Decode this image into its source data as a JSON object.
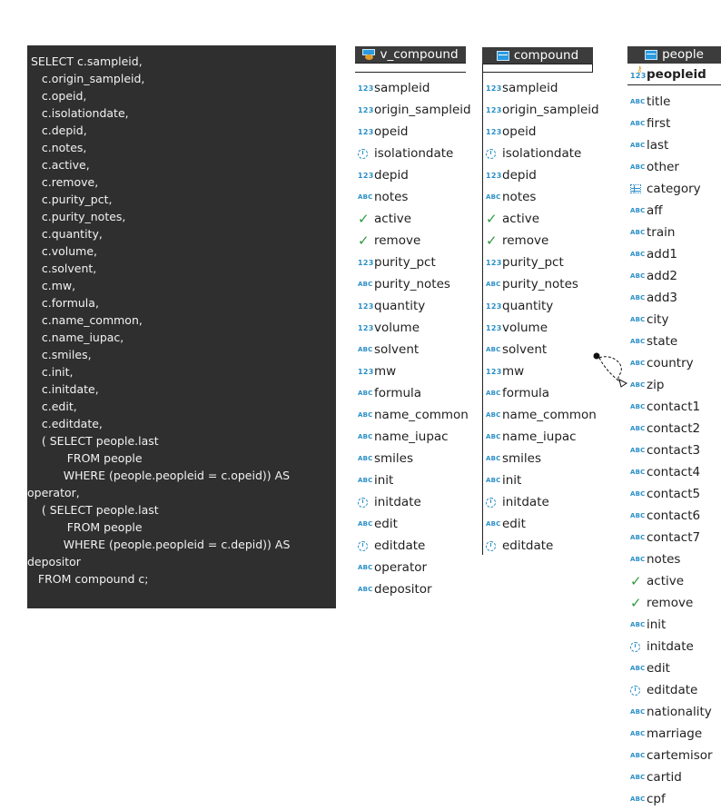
{
  "sql": {
    "lines": [
      " SELECT c.sampleid,",
      "    c.origin_sampleid,",
      "    c.opeid,",
      "    c.isolationdate,",
      "    c.depid,",
      "    c.notes,",
      "    c.active,",
      "    c.remove,",
      "    c.purity_pct,",
      "    c.purity_notes,",
      "    c.quantity,",
      "    c.volume,",
      "    c.solvent,",
      "    c.mw,",
      "    c.formula,",
      "    c.name_common,",
      "    c.name_iupac,",
      "    c.smiles,",
      "    c.init,",
      "    c.initdate,",
      "    c.edit,",
      "    c.editdate,",
      "    ( SELECT people.last",
      "           FROM people",
      "          WHERE (people.peopleid = c.opeid)) AS",
      "operator,",
      "    ( SELECT people.last",
      "           FROM people",
      "          WHERE (people.peopleid = c.depid)) AS",
      "depositor",
      "   FROM compound c;"
    ]
  },
  "v_compound": {
    "title": "v_compound",
    "columns": [
      {
        "name": "sampleid",
        "type": "num"
      },
      {
        "name": "origin_sampleid",
        "type": "num"
      },
      {
        "name": "opeid",
        "type": "num"
      },
      {
        "name": "isolationdate",
        "type": "clock"
      },
      {
        "name": "depid",
        "type": "num"
      },
      {
        "name": "notes",
        "type": "abc"
      },
      {
        "name": "active",
        "type": "check"
      },
      {
        "name": "remove",
        "type": "check"
      },
      {
        "name": "purity_pct",
        "type": "num"
      },
      {
        "name": "purity_notes",
        "type": "abc"
      },
      {
        "name": "quantity",
        "type": "num"
      },
      {
        "name": "volume",
        "type": "num"
      },
      {
        "name": "solvent",
        "type": "abc"
      },
      {
        "name": "mw",
        "type": "num"
      },
      {
        "name": "formula",
        "type": "abc"
      },
      {
        "name": "name_common",
        "type": "abc"
      },
      {
        "name": "name_iupac",
        "type": "abc"
      },
      {
        "name": "smiles",
        "type": "abc"
      },
      {
        "name": "init",
        "type": "abc"
      },
      {
        "name": "initdate",
        "type": "clock"
      },
      {
        "name": "edit",
        "type": "abc"
      },
      {
        "name": "editdate",
        "type": "clock"
      },
      {
        "name": "operator",
        "type": "abc"
      },
      {
        "name": "depositor",
        "type": "abc"
      }
    ]
  },
  "compound": {
    "title": "compound",
    "columns": [
      {
        "name": "sampleid",
        "type": "num"
      },
      {
        "name": "origin_sampleid",
        "type": "num"
      },
      {
        "name": "opeid",
        "type": "num"
      },
      {
        "name": "isolationdate",
        "type": "clock"
      },
      {
        "name": "depid",
        "type": "num"
      },
      {
        "name": "notes",
        "type": "abc"
      },
      {
        "name": "active",
        "type": "check"
      },
      {
        "name": "remove",
        "type": "check"
      },
      {
        "name": "purity_pct",
        "type": "num"
      },
      {
        "name": "purity_notes",
        "type": "abc"
      },
      {
        "name": "quantity",
        "type": "num"
      },
      {
        "name": "volume",
        "type": "num"
      },
      {
        "name": "solvent",
        "type": "abc"
      },
      {
        "name": "mw",
        "type": "num"
      },
      {
        "name": "formula",
        "type": "abc"
      },
      {
        "name": "name_common",
        "type": "abc"
      },
      {
        "name": "name_iupac",
        "type": "abc"
      },
      {
        "name": "smiles",
        "type": "abc"
      },
      {
        "name": "init",
        "type": "abc"
      },
      {
        "name": "initdate",
        "type": "clock"
      },
      {
        "name": "edit",
        "type": "abc"
      },
      {
        "name": "editdate",
        "type": "clock"
      }
    ]
  },
  "people": {
    "title": "people",
    "pk": "peopleid",
    "columns": [
      {
        "name": "title",
        "type": "abc"
      },
      {
        "name": "first",
        "type": "abc"
      },
      {
        "name": "last",
        "type": "abc"
      },
      {
        "name": "other",
        "type": "abc"
      },
      {
        "name": "category",
        "type": "grid"
      },
      {
        "name": "aff",
        "type": "abc"
      },
      {
        "name": "train",
        "type": "abc"
      },
      {
        "name": "add1",
        "type": "abc"
      },
      {
        "name": "add2",
        "type": "abc"
      },
      {
        "name": "add3",
        "type": "abc"
      },
      {
        "name": "city",
        "type": "abc"
      },
      {
        "name": "state",
        "type": "abc"
      },
      {
        "name": "country",
        "type": "abc"
      },
      {
        "name": "zip",
        "type": "abc"
      },
      {
        "name": "contact1",
        "type": "abc"
      },
      {
        "name": "contact2",
        "type": "abc"
      },
      {
        "name": "contact3",
        "type": "abc"
      },
      {
        "name": "contact4",
        "type": "abc"
      },
      {
        "name": "contact5",
        "type": "abc"
      },
      {
        "name": "contact6",
        "type": "abc"
      },
      {
        "name": "contact7",
        "type": "abc"
      },
      {
        "name": "notes",
        "type": "abc"
      },
      {
        "name": "active",
        "type": "check"
      },
      {
        "name": "remove",
        "type": "check"
      },
      {
        "name": "init",
        "type": "abc"
      },
      {
        "name": "initdate",
        "type": "clock"
      },
      {
        "name": "edit",
        "type": "abc"
      },
      {
        "name": "editdate",
        "type": "clock"
      },
      {
        "name": "nationality",
        "type": "abc"
      },
      {
        "name": "marriage",
        "type": "abc"
      },
      {
        "name": "cartemisor",
        "type": "abc"
      },
      {
        "name": "cartid",
        "type": "abc"
      },
      {
        "name": "cpf",
        "type": "abc"
      }
    ]
  },
  "type_glyphs": {
    "num": "123",
    "abc": "ABC",
    "check": "✓"
  },
  "colors": {
    "sql_background": "#2f2f2f",
    "header_background": "#3c3c3c",
    "type_icon": "#2a8fc7",
    "check_icon": "#2e9a3e"
  }
}
